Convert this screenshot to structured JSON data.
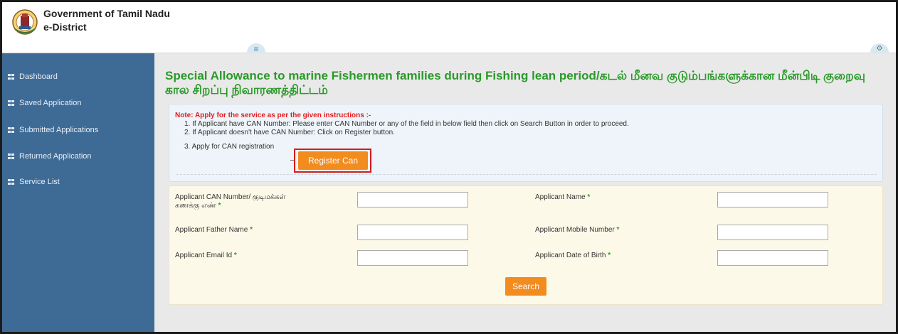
{
  "header": {
    "title": "Government of Tamil Nadu",
    "subtitle": "e-District",
    "menu_toggle_icon": "hamburger-icon",
    "settings_icon": "cogs-icon"
  },
  "sidebar": {
    "items": [
      {
        "label": "Dashboard",
        "icon": "grid-icon"
      },
      {
        "label": "Saved Application",
        "icon": "grid-icon"
      },
      {
        "label": "Submitted Applications",
        "icon": "grid-icon"
      },
      {
        "label": "Returned Application",
        "icon": "grid-icon"
      },
      {
        "label": "Service List",
        "icon": "grid-icon"
      }
    ]
  },
  "main": {
    "title": "Special Allowance to marine Fishermen families during Fishing lean period/கடல் மீனவ குடும்பங்களுக்கான மீன்பிடி குறைவு கால சிறப்பு நிவாரணத்திட்டம்",
    "instructions": {
      "note": "Note: Apply for the service as per the given instructions :-",
      "steps": [
        "1. If Applicant have CAN Number: Please enter CAN Number or any of the field in below field then click on Search Button in order to proceed.",
        "2. If Applicant doesn't have CAN Number: Click on Register button.",
        "3. Apply for CAN registration"
      ],
      "register_button": "Register Can"
    },
    "form": {
      "required_marker": "*",
      "fields": [
        {
          "label": "Applicant CAN Number/ குடிமக்கள்",
          "label_line2": "கணக்கு எண்",
          "value": ""
        },
        {
          "label": "Applicant Name",
          "value": ""
        },
        {
          "label": "Applicant Father Name",
          "value": ""
        },
        {
          "label": "Applicant Mobile Number",
          "value": ""
        },
        {
          "label": "Applicant Email Id",
          "value": ""
        },
        {
          "label": "Applicant Date of Birth",
          "value": ""
        }
      ],
      "search_button": "Search"
    }
  },
  "colors": {
    "sidebar_bg": "#3e6b96",
    "title_green": "#2a9a2a",
    "note_red": "#e02020",
    "button_orange": "#f28c1f",
    "highlight_red": "#d31c1c",
    "form_bg": "#fdf9e8",
    "instructions_bg": "#eef4f9"
  }
}
